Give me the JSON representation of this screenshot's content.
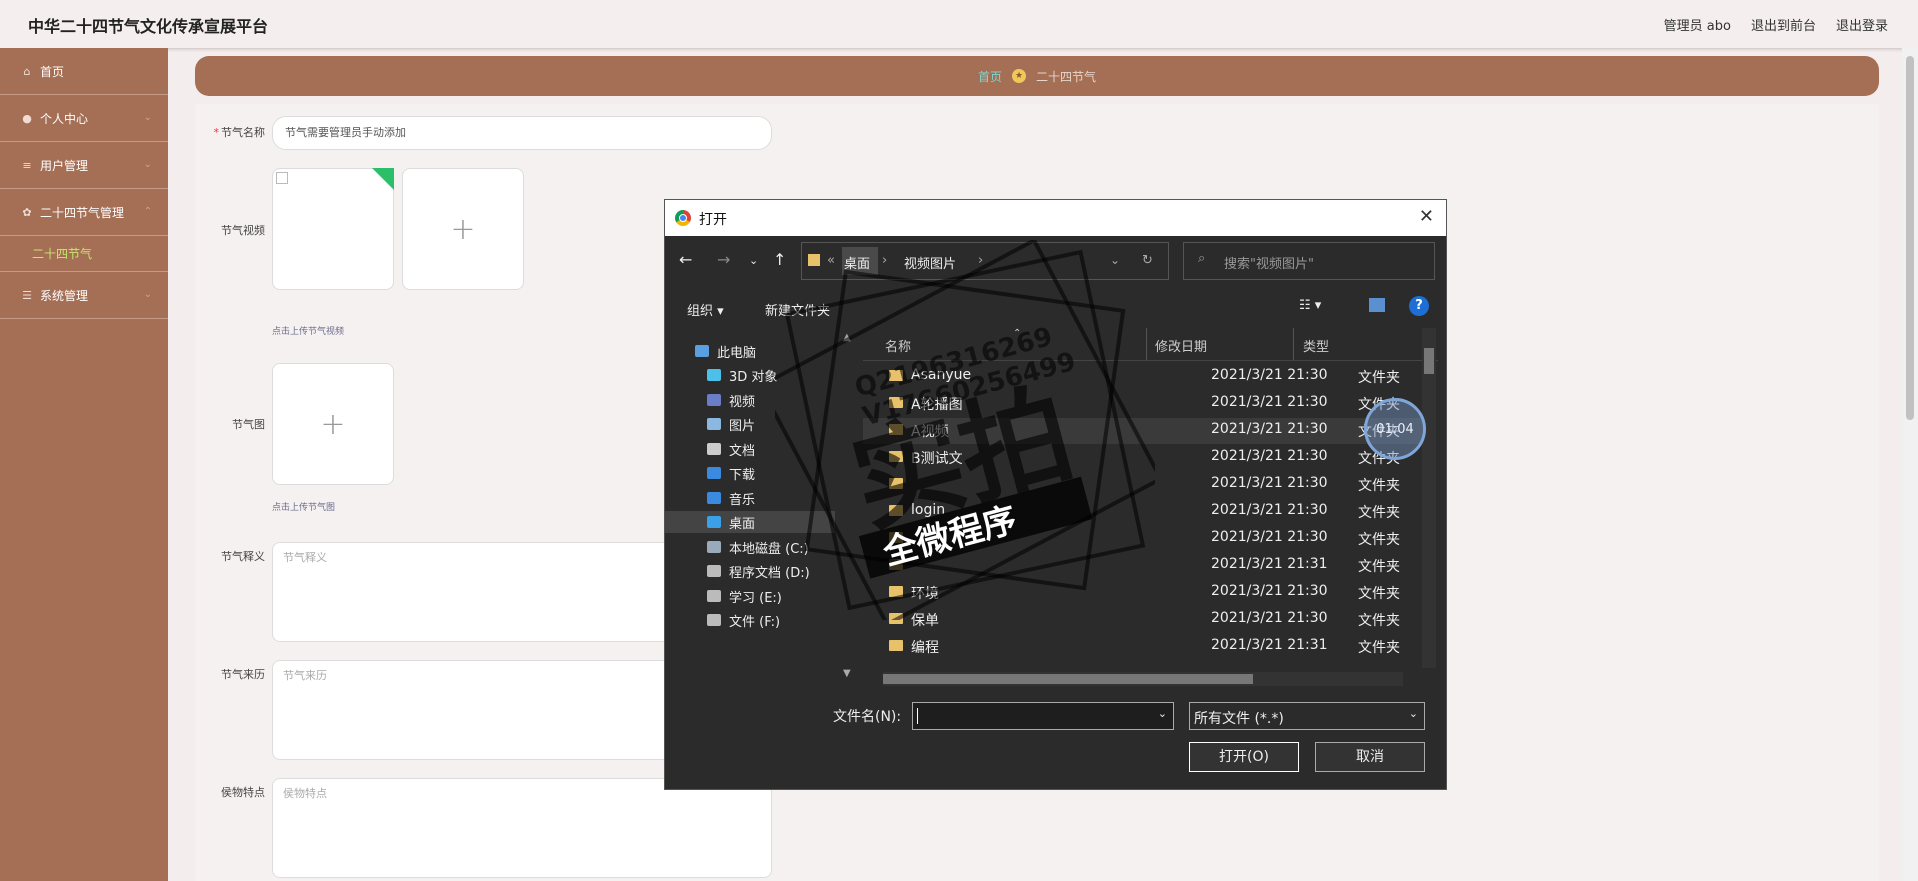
{
  "header": {
    "title": "中华二十四节气文化传承宣展平台",
    "links": [
      "管理员 abo",
      "退出到前台",
      "退出登录"
    ]
  },
  "sidebar": {
    "items": [
      {
        "label": "首页"
      },
      {
        "label": "个人中心"
      },
      {
        "label": "用户管理"
      },
      {
        "label": "二十四节气管理"
      }
    ],
    "sub": "二十四节气",
    "last": "系统管理"
  },
  "breadcrumb": {
    "home": "首页",
    "current": "二十四节气"
  },
  "form": {
    "name_label": "节气名称",
    "name_value": "节气需要管理员手动添加",
    "video_label": "节气视频",
    "video_tip": "点击上传节气视频",
    "image_label": "节气图",
    "image_tip": "点击上传节气图",
    "meaning_label": "节气释义",
    "meaning_ph": "节气释义",
    "origin_label": "节气来历",
    "origin_ph": "节气来历",
    "custom_label": "侯物特点",
    "custom_ph": "侯物特点"
  },
  "dialog": {
    "title": "打开",
    "path": {
      "prefix": "«",
      "seg1": "桌面",
      "seg2": "视频图片"
    },
    "search_ph": "搜索\"视频图片\"",
    "organize": "组织",
    "new_folder": "新建文件夹",
    "tree": [
      "此电脑",
      "3D 对象",
      "视频",
      "图片",
      "文档",
      "下载",
      "音乐",
      "桌面",
      "本地磁盘 (C:)",
      "程序文档 (D:)",
      "学习 (E:)",
      "文件 (F:)"
    ],
    "cols": {
      "name": "名称",
      "date": "修改日期",
      "type": "类型"
    },
    "files": [
      {
        "name": "Asanyue",
        "date": "2021/3/21 21:30",
        "type": "文件夹"
      },
      {
        "name": "A轮播图",
        "date": "2021/3/21 21:30",
        "type": "文件夹"
      },
      {
        "name": "A视频",
        "date": "2021/3/21 21:30",
        "type": "文件夹"
      },
      {
        "name": "B测试文",
        "date": "2021/3/21 21:30",
        "type": "文件夹"
      },
      {
        "name": "",
        "date": "2021/3/21 21:30",
        "type": "文件夹"
      },
      {
        "name": "login",
        "date": "2021/3/21 21:30",
        "type": "文件夹"
      },
      {
        "name": "",
        "date": "2021/3/21 21:30",
        "type": "文件夹"
      },
      {
        "name": "",
        "date": "2021/3/21 21:31",
        "type": "文件夹"
      },
      {
        "name": "环境",
        "date": "2021/3/21 21:30",
        "type": "文件夹"
      },
      {
        "name": "保单",
        "date": "2021/3/21 21:30",
        "type": "文件夹"
      },
      {
        "name": "编程",
        "date": "2021/3/21 21:31",
        "type": "文件夹"
      }
    ],
    "filename_label": "文件名(N):",
    "filter": "所有文件 (*.*)",
    "open_btn": "打开(O)",
    "cancel_btn": "取消"
  },
  "watermark": {
    "line1": "Q2196316269",
    "line2": "V17660256499",
    "big": "实拍",
    "banner": "全微程序"
  },
  "timer": "01:04"
}
